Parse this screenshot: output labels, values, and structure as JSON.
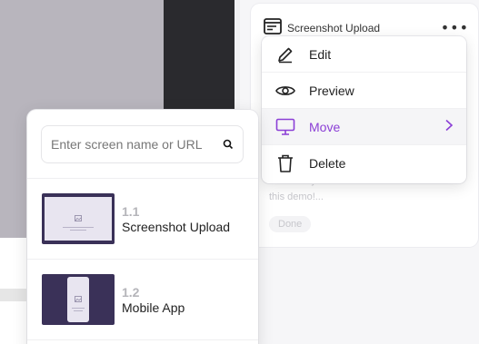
{
  "card": {
    "title": "Screenshot Upload",
    "more": "•••",
    "body_text": "Kudos to you! We've reached the end of this demo!...",
    "done_label": "Done"
  },
  "menu": {
    "items": [
      {
        "label": "Edit",
        "icon": "pencil-icon"
      },
      {
        "label": "Preview",
        "icon": "eye-icon"
      },
      {
        "label": "Move",
        "icon": "monitor-icon",
        "active": true
      },
      {
        "label": "Delete",
        "icon": "trash-icon"
      }
    ]
  },
  "picker": {
    "search_placeholder": "Enter screen name or URL",
    "screens": [
      {
        "number": "1.1",
        "name": "Screenshot Upload",
        "thumb": "desktop"
      },
      {
        "number": "1.2",
        "name": "Mobile App",
        "thumb": "mobile"
      }
    ]
  },
  "colors": {
    "accent": "#8b3fd6",
    "thumb_bg": "#3a3158"
  }
}
